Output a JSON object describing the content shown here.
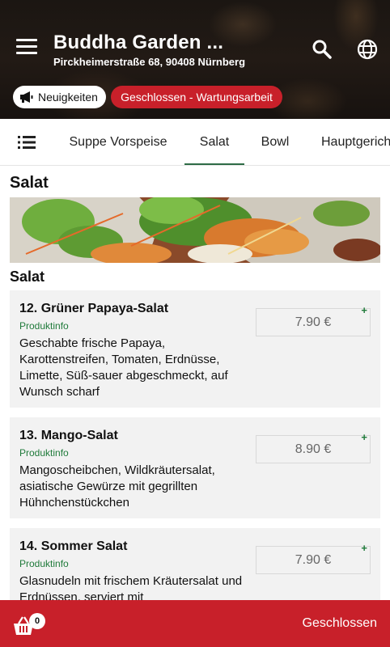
{
  "header": {
    "title": "Buddha Garden ...",
    "address": "Pirckheimerstraße 68, 90408 Nürnberg",
    "news_label": "Neuigkeiten",
    "status_label": "Geschlossen - Wartungsarbeit"
  },
  "tabs": [
    {
      "label": "Suppe Vorspeise"
    },
    {
      "label": "Salat"
    },
    {
      "label": "Bowl"
    },
    {
      "label": "Hauptgericht"
    }
  ],
  "section": {
    "title": "Salat",
    "subtitle": "Salat"
  },
  "items": [
    {
      "name": "12. Grüner Papaya-Salat",
      "info": "Produktinfo",
      "description": "Geschabte frische Papaya, Karottenstreifen, Tomaten, Erdnüsse, Limette, Süß-sauer abgeschmeckt, auf Wunsch scharf",
      "price": "7.90 €"
    },
    {
      "name": "13. Mango-Salat",
      "info": "Produktinfo",
      "description": "Mangoscheibchen, Wildkräutersalat, asiatische Gewürze mit gegrillten Hühnchenstückchen",
      "price": "8.90 €"
    },
    {
      "name": "14. Sommer Salat",
      "info": "Produktinfo",
      "description": "Glasnudeln mit frischem Kräutersalat und Erdnüssen, serviert mit",
      "price": "7.90 €"
    }
  ],
  "plus_symbol": "+",
  "bottom_bar": {
    "cart_count": "0",
    "status": "Geschlossen"
  },
  "colors": {
    "brand_red": "#c8202a",
    "accent_green": "#1f7a3a",
    "tab_underline": "#2e6b45"
  }
}
